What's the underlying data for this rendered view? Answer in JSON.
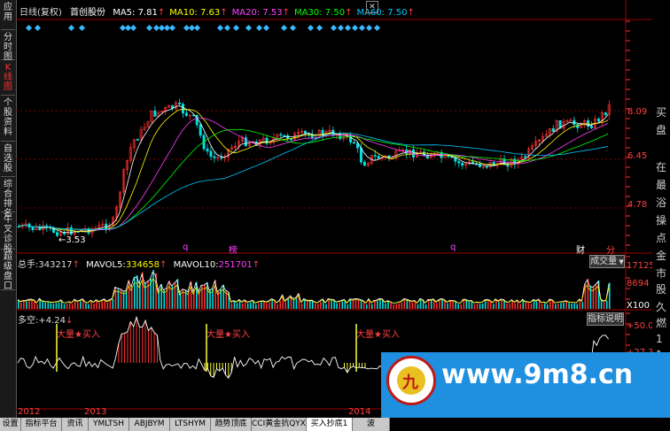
{
  "left_tabs": [
    "应用",
    "分时图",
    "K线图",
    "个股资料",
    "自选股",
    "综合排名",
    "牛叉诊股",
    "超级盘口"
  ],
  "active_left_tab": 2,
  "header": {
    "period": "日线(复权)",
    "stock": "首创股份",
    "ma": [
      {
        "label": "MA5:",
        "value": "7.81",
        "arrow": "↑",
        "color": "#ffffff"
      },
      {
        "label": "MA10:",
        "value": "7.63",
        "arrow": "↑",
        "color": "#ffff00"
      },
      {
        "label": "MA20:",
        "value": "7.53",
        "arrow": "↑",
        "color": "#ff40ff"
      },
      {
        "label": "MA30:",
        "value": "7.50",
        "arrow": "↑",
        "color": "#00ff00"
      },
      {
        "label": "MA60:",
        "value": "7.50",
        "arrow": "↑",
        "color": "#00c8ff"
      }
    ]
  },
  "price_axis": [
    "8.09",
    "6.45",
    "4.78"
  ],
  "low_marker": "3.53",
  "event_markers": [
    {
      "text": "q",
      "color": "#ff40ff"
    },
    {
      "text": "榜",
      "color": "#ff40ff"
    },
    {
      "text": "q",
      "color": "#ff40ff"
    },
    {
      "text": "财",
      "color": "#ffffff"
    },
    {
      "text": "分",
      "color": "#ff4040"
    }
  ],
  "volume": {
    "label": "总手:",
    "value": "343217",
    "mavol5_label": "MAVOL5:",
    "mavol5": "334658",
    "mavol10_label": "MAVOL10:",
    "mavol10": "251701",
    "arrow": "↑",
    "dropdown": "成交量",
    "axis": [
      "17125",
      "8694",
      "X100"
    ]
  },
  "indicator": {
    "label": "多空:",
    "value": "+4.24",
    "arrow": "↓",
    "button": "指标说明",
    "axis": [
      "+50.00",
      "+27.30"
    ],
    "signal_text": "大量★买入"
  },
  "years": [
    "2012",
    "2013",
    "2014"
  ],
  "bottom_tabs": [
    "设置",
    "指标平台",
    "资讯",
    "YMLTSH",
    "ABJBYM",
    "LTSHYM",
    "趋势顶底",
    "CCI黄金抗QYX",
    "买入抄底1",
    "波"
  ],
  "active_bottom_tab": 8,
  "side_chars": [
    "买",
    "盘",
    "在",
    "最",
    "浴",
    "操",
    "点",
    "金",
    "市",
    "股",
    "久",
    "燃",
    "1",
    "1",
    "1",
    "1",
    "1"
  ],
  "watermark": {
    "url": "www.9m8.cn",
    "logo_char": "九"
  },
  "colors": {
    "up": "#ff3030",
    "down": "#00e0e0",
    "grid": "#800000",
    "axis": "#ff3030"
  }
}
